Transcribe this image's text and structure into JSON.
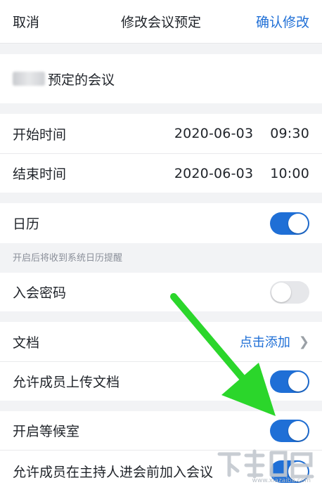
{
  "header": {
    "cancel": "取消",
    "title": "修改会议预定",
    "confirm": "确认修改"
  },
  "topic": {
    "text": "预定的会议"
  },
  "times": {
    "start_label": "开始时间",
    "start_date": "2020-06-03",
    "start_time": "09:30",
    "end_label": "结束时间",
    "end_date": "2020-06-03",
    "end_time": "10:00"
  },
  "calendar": {
    "label": "日历",
    "on": true,
    "hint": "开启后将收到系统日历提醒"
  },
  "password": {
    "label": "入会密码",
    "on": false
  },
  "docs": {
    "label": "文档",
    "action": "点击添加"
  },
  "settings": [
    {
      "label": "允许成员上传文档",
      "on": true
    },
    {
      "label": "开启等候室",
      "on": true
    },
    {
      "label": "允许成员在主持人进会前加入会议",
      "on": true
    }
  ],
  "colors": {
    "accent": "#1f6fd6",
    "arrow": "#2bd62b"
  },
  "icons": {
    "chevron": "chevron-right-icon",
    "arrow": "green-arrow-annotation"
  },
  "watermark": {
    "site": "www.xiazaiba.com"
  }
}
